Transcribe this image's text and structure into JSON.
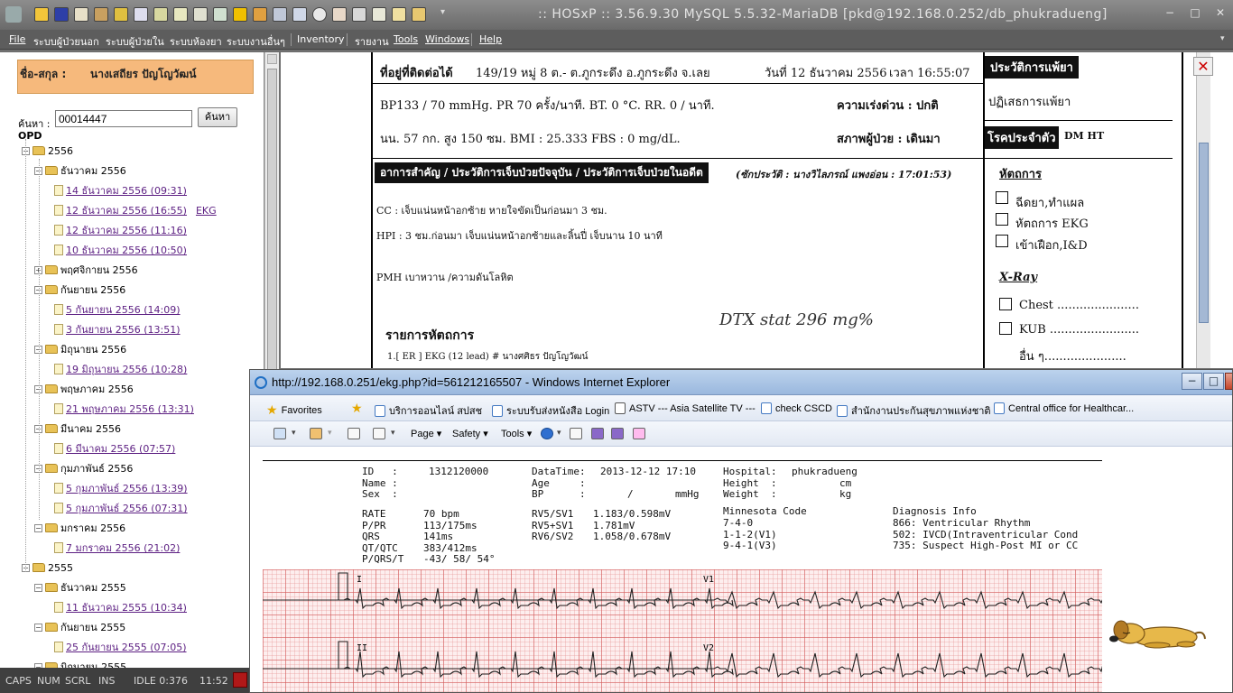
{
  "app": {
    "title": ":: HOSxP :: 3.56.9.30 MySQL 5.5.32-MariaDB [pkd@192.168.0.252/db_phukradueng]",
    "window_controls": [
      "−",
      "□",
      "✕"
    ]
  },
  "menu": [
    "File",
    "ระบบผู้ป่วยนอก",
    "ระบบผู้ป่วยใน",
    "ระบบห้องยา",
    "ระบบงานอื่นๆ",
    "Inventory",
    "รายงาน",
    "Tools",
    "Windows",
    "Help"
  ],
  "patient": {
    "name_label": "ชื่อ-สกุล :",
    "name_value": "นางเสถียร ปัญโญวัฒน์"
  },
  "search": {
    "label": "ค้นหา :",
    "value": "00014447",
    "button": "ค้นหา"
  },
  "tree": {
    "root": "OPD",
    "rows": [
      {
        "label": "2556",
        "type": "year"
      },
      {
        "label": "ธันวาคม 2556",
        "type": "month"
      },
      {
        "label": "14 ธันวาคม 2556 (09:31)",
        "type": "visit"
      },
      {
        "label": "12 ธันวาคม 2556 (16:55)",
        "type": "visit",
        "extra": "EKG"
      },
      {
        "label": "12 ธันวาคม 2556 (11:16)",
        "type": "visit"
      },
      {
        "label": "10 ธันวาคม 2556 (10:50)",
        "type": "visit"
      },
      {
        "label": "พฤศจิกายน 2556",
        "type": "month-collapsed"
      },
      {
        "label": "กันยายน 2556",
        "type": "month"
      },
      {
        "label": "5 กันยายน 2556 (14:09)",
        "type": "visit"
      },
      {
        "label": "3 กันยายน 2556 (13:51)",
        "type": "visit"
      },
      {
        "label": "มิถุนายน 2556",
        "type": "month"
      },
      {
        "label": "19 มิถุนายน 2556 (10:28)",
        "type": "visit"
      },
      {
        "label": "พฤษภาคม 2556",
        "type": "month"
      },
      {
        "label": "21 พฤษภาคม 2556 (13:31)",
        "type": "visit"
      },
      {
        "label": "มีนาคม 2556",
        "type": "month"
      },
      {
        "label": "6 มีนาคม 2556 (07:57)",
        "type": "visit"
      },
      {
        "label": "กุมภาพันธ์ 2556",
        "type": "month"
      },
      {
        "label": "5 กุมภาพันธ์ 2556 (13:39)",
        "type": "visit"
      },
      {
        "label": "5 กุมภาพันธ์ 2556 (07:31)",
        "type": "visit"
      },
      {
        "label": "มกราคม 2556",
        "type": "month"
      },
      {
        "label": "7 มกราคม 2556 (21:02)",
        "type": "visit"
      },
      {
        "label": "2555",
        "type": "year"
      },
      {
        "label": "ธันวาคม 2555",
        "type": "month"
      },
      {
        "label": "11 ธันวาคม 2555 (10:34)",
        "type": "visit"
      },
      {
        "label": "กันยายน 2555",
        "type": "month"
      },
      {
        "label": "25 กันยายน 2555 (07:05)",
        "type": "visit"
      },
      {
        "label": "มิถุนายน 2555",
        "type": "month"
      }
    ]
  },
  "doc": {
    "address_label": "ที่อยู่ที่ติดต่อได้",
    "address": "149/19 หมู่ 8 ต.- ต.ภูกระดึง อ.ภูกระดึง จ.เลย",
    "date": "วันที่ 12 ธันวาคม 2556",
    "time": "เวลา 16:55:07",
    "allergy_head": "ประวัติการแพ้ยา",
    "allergy": "ปฏิเสธการแพ้ยา",
    "vitals1": "BP133 / 70 mmHg.  PR  70  ครั้ง/นาที.   BT.  0     °C.  RR.  0   / นาที.",
    "urgency": "ความเร่งด่วน : ปกติ",
    "vitals2": "นน. 57    กก.  สูง  150  ซม.       BMI :  25.333   FBS :   0      mg/dL.",
    "status": "สภาพผู้ป่วย :   เดินมา",
    "chronic_head": "โรคประจำตัว",
    "chronic": "DM HT",
    "complaint_head": "อาการสำคัญ / ประวัติการเจ็บป่วยปัจจุบัน / ประวัติการเจ็บป่วยในอดีต",
    "recorder": "(ซักประวัติ : นางวิไลภรณ์ แพงอ่อน : 17:01:53)",
    "cc": "CC :  เจ็บแน่นหน้าอกซ้าย หายใจขัดเป็นก่อนมา 3 ชม.",
    "hpi": "HPI : 3 ชม.ก่อนมา เจ็บแน่นหน้าอกซ้ายและลิ้นปี่ เจ็บนาน 10 นาที",
    "pmh": "PMH  เบาหวาน /ความดันโลหิต",
    "handwritten": "DTX  stat   296 mg%",
    "procedures_head": "รายการหัตถการ",
    "procedure_item": "1.[ ER ] EKG (12 lead)  #  นางศศิธร  ปัญโญวัฒน์",
    "proc_head": "หัตถการ",
    "proc_items": [
      "ฉีดยา,ทำแผล",
      "หัตถการ EKG",
      "เข้าเฝือก,I&D"
    ],
    "xray_head": "X-Ray",
    "xray_items": [
      "Chest ......................",
      "KUB ........................"
    ],
    "other": "อื่น ๆ......................"
  },
  "ie": {
    "title": "http://192.168.0.251/ekg.php?id=561212165507 - Windows Internet Explorer",
    "favorites_label": "Favorites",
    "favorites": [
      "บริการออนไลน์ สปสช",
      "ระบบรับส่งหนังสือ Login",
      "ASTV --- Asia Satellite TV ---",
      "check CSCD",
      "สำนักงานประกันสุขภาพแห่งชาติ",
      "Central office for Healthcar..."
    ],
    "commands": [
      "Page",
      "Safety",
      "Tools"
    ]
  },
  "ekg": {
    "col1_labels": "ID   :\nName :\nSex  :",
    "col1_values": "1312120000",
    "col2": "DataTime:\nAge     :\nBP      :",
    "col2_values": "2013-12-12 17:10",
    "bp_unit": "/       mmHg",
    "col3": "Hospital:\nHeight  :\nWeight  :",
    "col3_values": "phukradueng\n        cm\n        kg",
    "meas_labels": "RATE\nP/PR\nQRS\nQT/QTC\nP/QRS/T",
    "meas_values": "70 bpm\n113/175ms\n141ms\n383/412ms\n-43/ 58/ 54°",
    "rv_labels": "RV5/SV1\nRV5+SV1\nRV6/SV2",
    "rv_values": "1.183/0.598mV\n1.781mV\n1.058/0.678mV",
    "minnesota_head": "Minnesota Code",
    "minnesota": "7-4-0\n1-1-2(V1)\n9-4-1(V3)",
    "diag_head": "Diagnosis Info",
    "diag": "866: Ventricular Rhythm\n502: IVCD(Intraventricular Cond\n735: Suspect High-Post MI or CC",
    "leads": [
      "I",
      "V1",
      "II",
      "V2"
    ]
  },
  "status": {
    "caps": "CAPS",
    "num": "NUM",
    "scrl": "SCRL",
    "ins": "INS",
    "idle": "IDLE 0:376",
    "clock": "11:52"
  },
  "colors": {
    "name_box": "#f6b97c",
    "link": "#5c1f82",
    "ekg_grid": "#fdeeee"
  }
}
